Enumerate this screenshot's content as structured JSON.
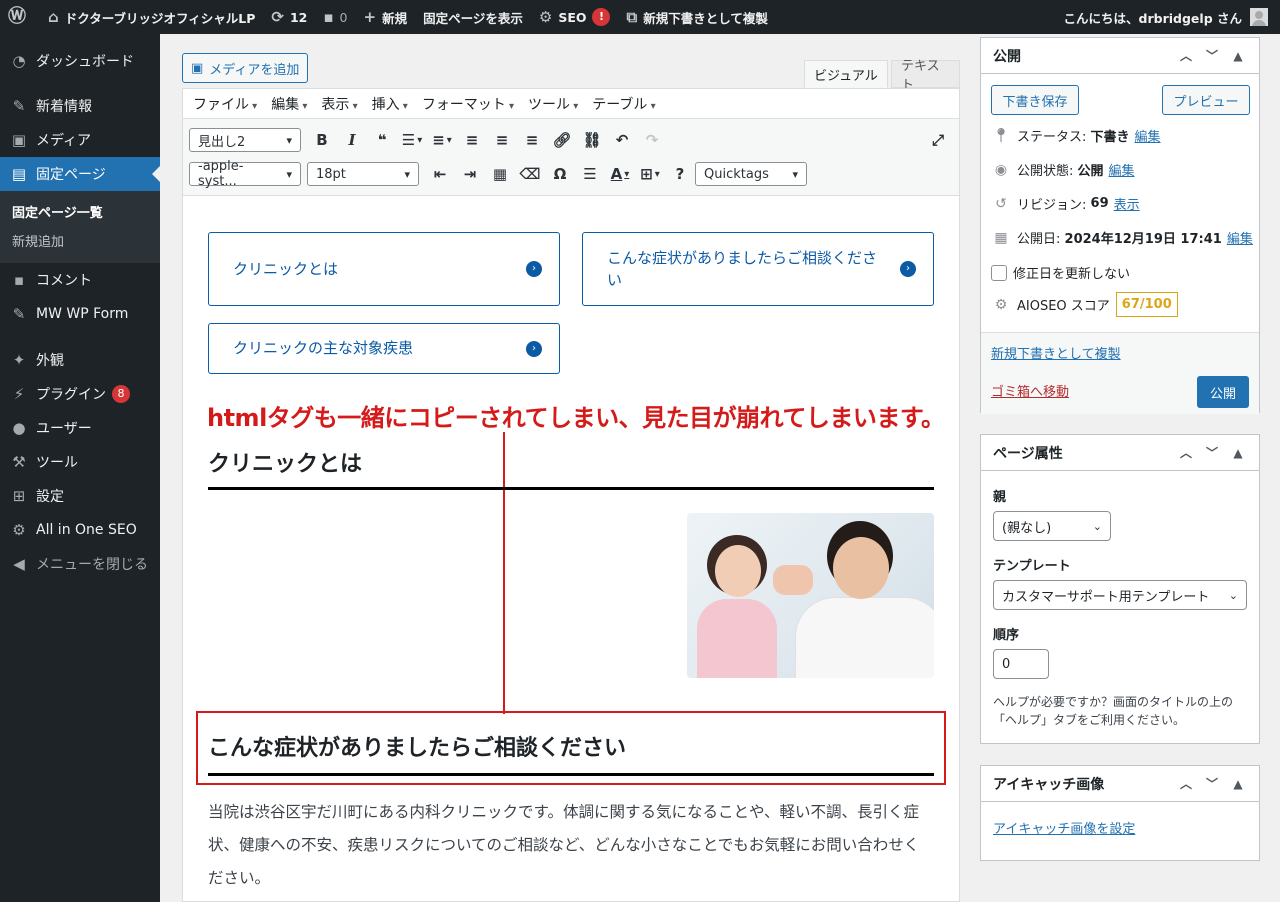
{
  "adminbar": {
    "site_name": "ドクターブリッジオフィシャルLP",
    "updates_count": "12",
    "comments_count": "0",
    "new_label": "新規",
    "view_page_label": "固定ページを表示",
    "seo_label": "SEO",
    "seo_badge": "!",
    "duplicate_label": "新規下書きとして複製",
    "greeting": "こんにちは、drbridgelp さん"
  },
  "sidebar": {
    "items": [
      {
        "label": "ダッシュボード",
        "icon": "dashboard-icon"
      },
      {
        "label": "新着情報",
        "icon": "pin-icon"
      },
      {
        "label": "メディア",
        "icon": "media-icon"
      },
      {
        "label": "固定ページ",
        "icon": "pages-icon"
      },
      {
        "label": "コメント",
        "icon": "comment-icon"
      },
      {
        "label": "MW WP Form",
        "icon": "pin-icon"
      },
      {
        "label": "外観",
        "icon": "appearance-icon"
      },
      {
        "label": "プラグイン",
        "icon": "plugin-icon"
      },
      {
        "label": "ユーザー",
        "icon": "user-icon"
      },
      {
        "label": "ツール",
        "icon": "wrench-icon"
      },
      {
        "label": "設定",
        "icon": "settings-icon"
      },
      {
        "label": "All in One SEO",
        "icon": "aioseo-icon"
      },
      {
        "label": "メニューを閉じる",
        "icon": "collapse-icon"
      }
    ],
    "submenu": [
      "固定ページ一覧",
      "新規追加"
    ],
    "plugin_badge": "8"
  },
  "editor": {
    "add_media": "メディアを追加",
    "tab_visual": "ビジュアル",
    "tab_text": "テキスト",
    "menubar": [
      "ファイル",
      "編集",
      "表示",
      "挿入",
      "フォーマット",
      "ツール",
      "テーブル"
    ],
    "format_select": "見出し2",
    "font_select": "-apple-syst...",
    "size_select": "18pt",
    "quicktags_select": "Quicktags"
  },
  "content": {
    "nav_boxes": [
      "クリニックとは",
      "こんな症状がありましたらご相談ください",
      "クリニックの主な対象疾患"
    ],
    "annotation": "htmlタグも一緒にコピーされてしまい、見た目が崩れてしまいます。",
    "heading1": "クリニックとは",
    "heading2": "こんな症状がありましたらご相談ください",
    "paragraph": "当院は渋谷区宇だ川町にある内科クリニックです。体調に関する気になることや、軽い不調、長引く症状、健康への不安、疾患リスクについてのご相談など、どんな小さなことでもお気軽にお問い合わせください。"
  },
  "publish": {
    "title": "公開",
    "save_draft": "下書き保存",
    "preview": "プレビュー",
    "status_label": "ステータス:",
    "status_value": "下書き",
    "visibility_label": "公開状態:",
    "visibility_value": "公開",
    "revisions_label": "リビジョン:",
    "revisions_value": "69",
    "revisions_link": "表示",
    "date_label": "公開日:",
    "date_value": "2024年12月19日 17:41",
    "edit_link": "編集",
    "update_date_checkbox": "修正日を更新しない",
    "aioseo_label": "AIOSEO スコア",
    "aioseo_score": "67/100",
    "duplicate_link": "新規下書きとして複製",
    "trash_link": "ゴミ箱へ移動",
    "publish_button": "公開"
  },
  "attributes": {
    "title": "ページ属性",
    "parent_label": "親",
    "parent_value": "(親なし)",
    "template_label": "テンプレート",
    "template_value": "カスタマーサポート用テンプレート",
    "order_label": "順序",
    "order_value": "0",
    "help_text": "ヘルプが必要ですか？画面のタイトルの上の「ヘルプ」タブをご利用ください。"
  },
  "featured": {
    "title": "アイキャッチ画像",
    "set_link": "アイキャッチ画像を設定"
  }
}
